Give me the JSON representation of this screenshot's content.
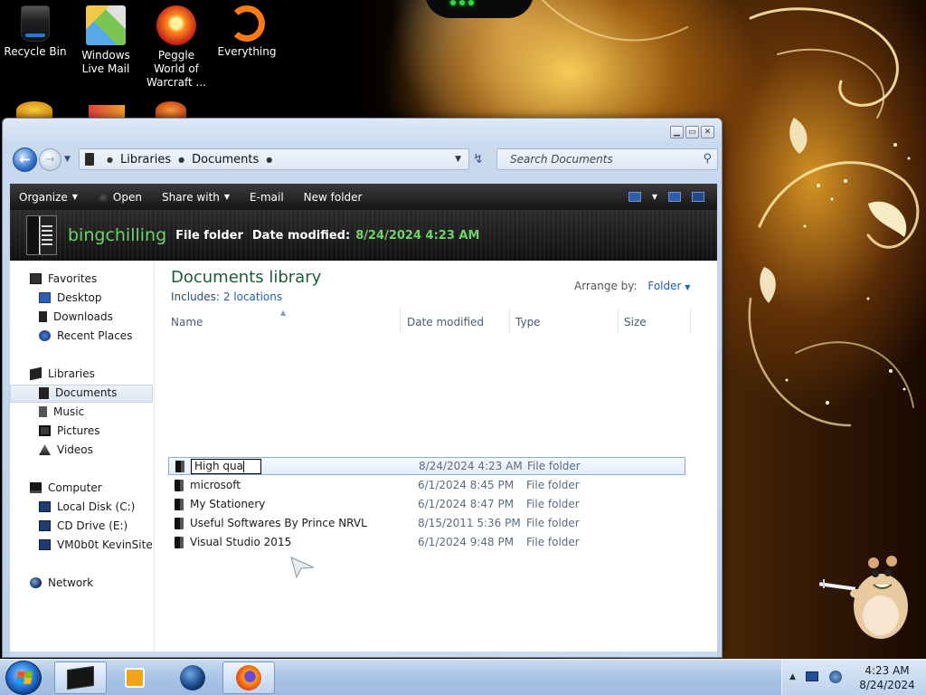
{
  "desktop": {
    "icons": [
      {
        "label": "Recycle Bin",
        "icon": "recycle-bin-icon"
      },
      {
        "label": "Windows Live Mail",
        "icon": "windows-live-mail-icon"
      },
      {
        "label": "Peggle World of Warcraft ...",
        "icon": "peggle-icon"
      },
      {
        "label": "Everything",
        "icon": "everything-icon"
      }
    ]
  },
  "window": {
    "address": {
      "crumbs": [
        "Libraries",
        "Documents"
      ]
    },
    "search": {
      "placeholder": "Search Documents"
    },
    "command_bar": {
      "organize": "Organize",
      "open": "Open",
      "share_with": "Share with",
      "email": "E-mail",
      "new_folder": "New folder"
    },
    "details": {
      "name": "bingchilling",
      "type": "File folder",
      "modified_label": "Date modified:",
      "modified_value": "8/24/2024 4:23 AM"
    },
    "nav": {
      "favorites": "Favorites",
      "desktop": "Desktop",
      "downloads": "Downloads",
      "recent": "Recent Places",
      "libraries": "Libraries",
      "documents": "Documents",
      "music": "Music",
      "pictures": "Pictures",
      "videos": "Videos",
      "computer": "Computer",
      "local_disk": "Local Disk (C:)",
      "cd_drive": "CD Drive (E:)",
      "network_drive": "VM0b0t KevinSite",
      "network": "Network"
    },
    "library": {
      "title": "Documents library",
      "includes_label": "Includes:",
      "includes_link": "2 locations",
      "arrange_label": "Arrange by:",
      "arrange_value": "Folder"
    },
    "columns": {
      "name": "Name",
      "date": "Date modified",
      "type": "Type",
      "size": "Size"
    },
    "rename_value": "High qua",
    "files": [
      {
        "name": "",
        "date": "8/24/2024 4:23 AM",
        "type": "File folder"
      },
      {
        "name": "microsoft",
        "date": "6/1/2024 8:45 PM",
        "type": "File folder"
      },
      {
        "name": "My Stationery",
        "date": "6/1/2024 8:47 PM",
        "type": "File folder"
      },
      {
        "name": "Useful Softwares By Prince NRVL",
        "date": "8/15/2011 5:36 PM",
        "type": "File folder"
      },
      {
        "name": "Visual Studio 2015",
        "date": "6/1/2024 9:48 PM",
        "type": "File folder"
      }
    ]
  },
  "taskbar": {
    "clock_time": "4:23 AM",
    "clock_date": "8/24/2024"
  }
}
